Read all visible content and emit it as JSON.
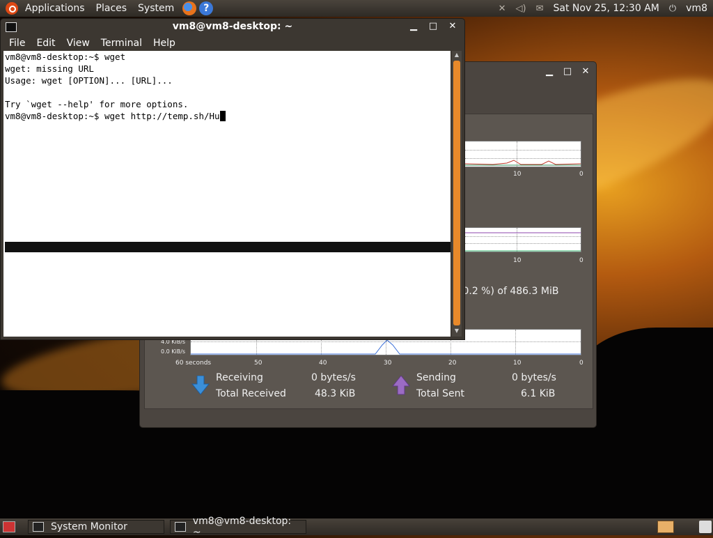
{
  "top_panel": {
    "menus": [
      "Applications",
      "Places",
      "System"
    ],
    "datetime": "Sat Nov 25, 12:30 AM",
    "user": "vm8"
  },
  "terminal": {
    "title": "vm8@vm8-desktop: ~",
    "menus": [
      "File",
      "Edit",
      "View",
      "Terminal",
      "Help"
    ],
    "lines": [
      "vm8@vm8-desktop:~$ wget",
      "wget: missing URL",
      "Usage: wget [OPTION]... [URL]...",
      "",
      "Try `wget --help' for more options.",
      "vm8@vm8-desktop:~$ wget http://temp.sh/Hu"
    ]
  },
  "system_monitor": {
    "cpu_ticks": [
      "10",
      "0"
    ],
    "mem_ticks": [
      "10",
      "0"
    ],
    "swap_text": "(0.2 %) of 486.3 MiB",
    "net_yticks": [
      "4.0 KiB/s",
      "0.0 KiB/s"
    ],
    "net_xticks": [
      "60 seconds",
      "50",
      "40",
      "30",
      "20",
      "10",
      "0"
    ],
    "receiving_label": "Receiving",
    "receiving_value": "0 bytes/s",
    "total_received_label": "Total Received",
    "total_received_value": "48.3 KiB",
    "sending_label": "Sending",
    "sending_value": "0 bytes/s",
    "total_sent_label": "Total Sent",
    "total_sent_value": "6.1 KiB",
    "colors": {
      "receiving": "#3b8fd8",
      "sending": "#9b6bc4"
    }
  },
  "bottom_panel": {
    "tasks": [
      "System Monitor",
      "vm8@vm8-desktop: ~"
    ]
  }
}
